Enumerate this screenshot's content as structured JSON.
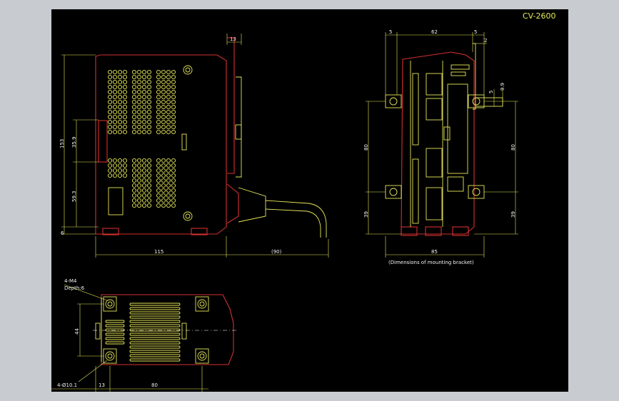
{
  "drawing": {
    "title": "CV-2600",
    "bracket_note": "(Dimensions of mounting bracket)"
  },
  "dims": {
    "top13": "13",
    "h153": "153",
    "d35_9": "35.9",
    "d59_3": "59.3",
    "d6": "6",
    "w115": "115",
    "cable90": "(90)",
    "f5a": "5",
    "f62": "62",
    "f5b": "5",
    "f2": "2",
    "f5c": "5",
    "f9_9": "9.9",
    "f80l": "80",
    "f80r": "80",
    "f39l": "39",
    "f39r": "39",
    "w85": "85",
    "m4": "4-M4",
    "depth": "Depth:6",
    "b44": "44",
    "hole": "4-Ø10.1",
    "b13": "13",
    "b80": "80"
  },
  "colors": {
    "background": "#000000",
    "outline": "#d23030",
    "detail": "#e8e85a"
  }
}
